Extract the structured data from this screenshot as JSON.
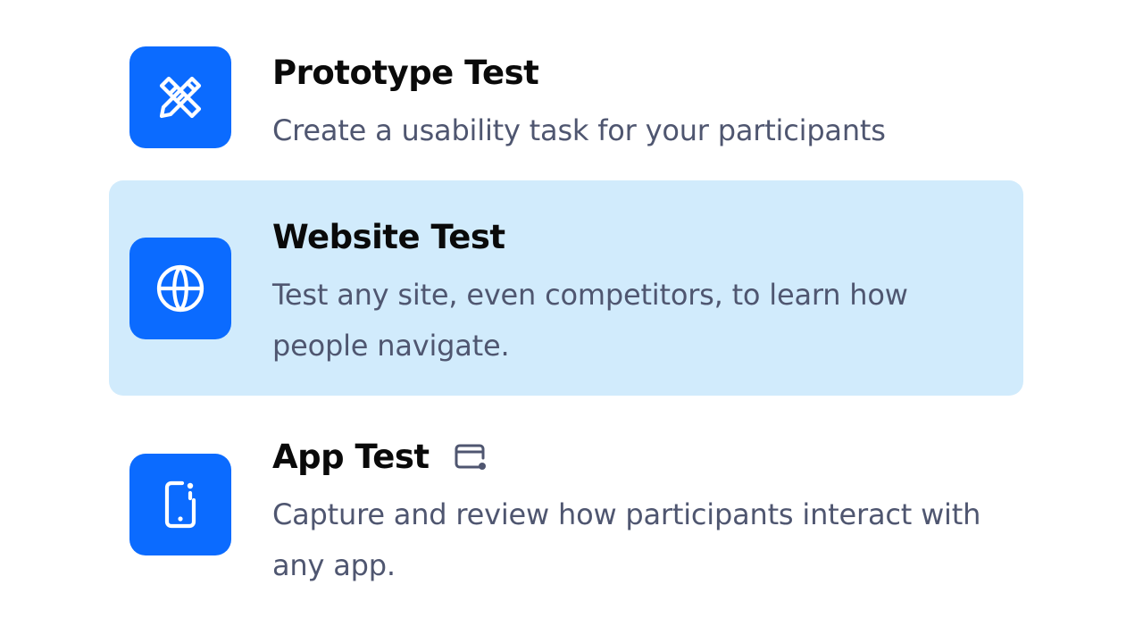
{
  "options": [
    {
      "title": "Prototype Test",
      "description": "Create a usability task for your participants",
      "icon": "pencil-ruler-icon",
      "selected": false
    },
    {
      "title": "Website Test",
      "description": "Test any site, even competitors, to learn how people navigate.",
      "icon": "globe-icon",
      "selected": true
    },
    {
      "title": "App Test",
      "description": "Capture and review how participants interact with any app.",
      "icon": "mobile-phone-icon",
      "badge_icon": "screen-record-icon",
      "selected": false
    }
  ],
  "colors": {
    "icon_tile": "#0b6bff",
    "selected_background": "#d1ebfc",
    "title": "#0a0a0a",
    "description": "#4f5670"
  }
}
